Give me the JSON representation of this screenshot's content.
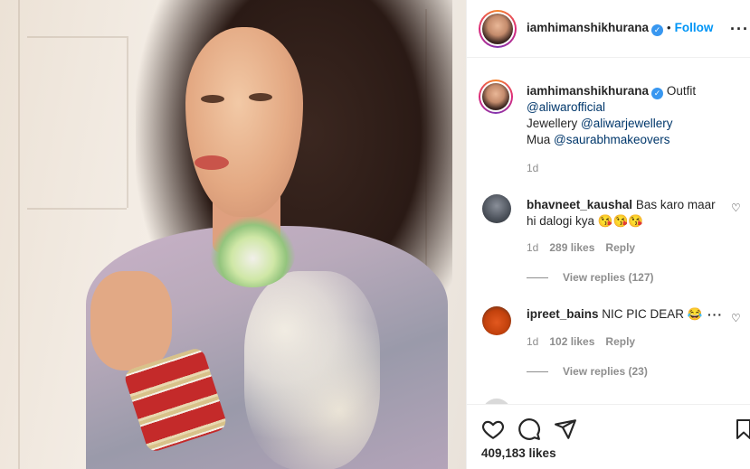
{
  "post": {
    "image_alt": "Woman in pastel embroidered outfit with green necklace and red bangles"
  },
  "header": {
    "username": "iamhimanshikhurana",
    "verified_icon": "verified-badge-icon",
    "separator": "•",
    "follow_label": "Follow",
    "more_icon": "more-options-icon",
    "more_glyph": "···"
  },
  "caption": {
    "username": "iamhimanshikhurana",
    "line1": "Outfit",
    "line2_mention": "@aliwarofficial",
    "line3_prefix": "Jewellery ",
    "line3_mention": "@aliwarjewellery",
    "line4_prefix": "Mua ",
    "line4_mention": "@saurabhmakeovers",
    "time": "1d"
  },
  "comments": [
    {
      "username": "bhavneet_kaushal",
      "text_line1": "Bas karo maar",
      "text_line2": "hi dalogi kya 😘😘😘",
      "time": "1d",
      "likes": "289 likes",
      "reply": "Reply",
      "view_replies": "View replies (127)"
    },
    {
      "username": "ipreet_bains",
      "text": "NIC PIC DEAR 😂",
      "time": "1d",
      "likes": "102 likes",
      "reply": "Reply",
      "view_replies": "View replies (23)"
    }
  ],
  "actions": {
    "like_icon": "heart-icon",
    "comment_icon": "comment-icon",
    "share_icon": "share-icon",
    "save_icon": "bookmark-icon"
  },
  "likes_count": "409,183 likes",
  "colors": {
    "accent": "#0095f6",
    "verified": "#3897f0",
    "muted": "#8e8e8e"
  }
}
